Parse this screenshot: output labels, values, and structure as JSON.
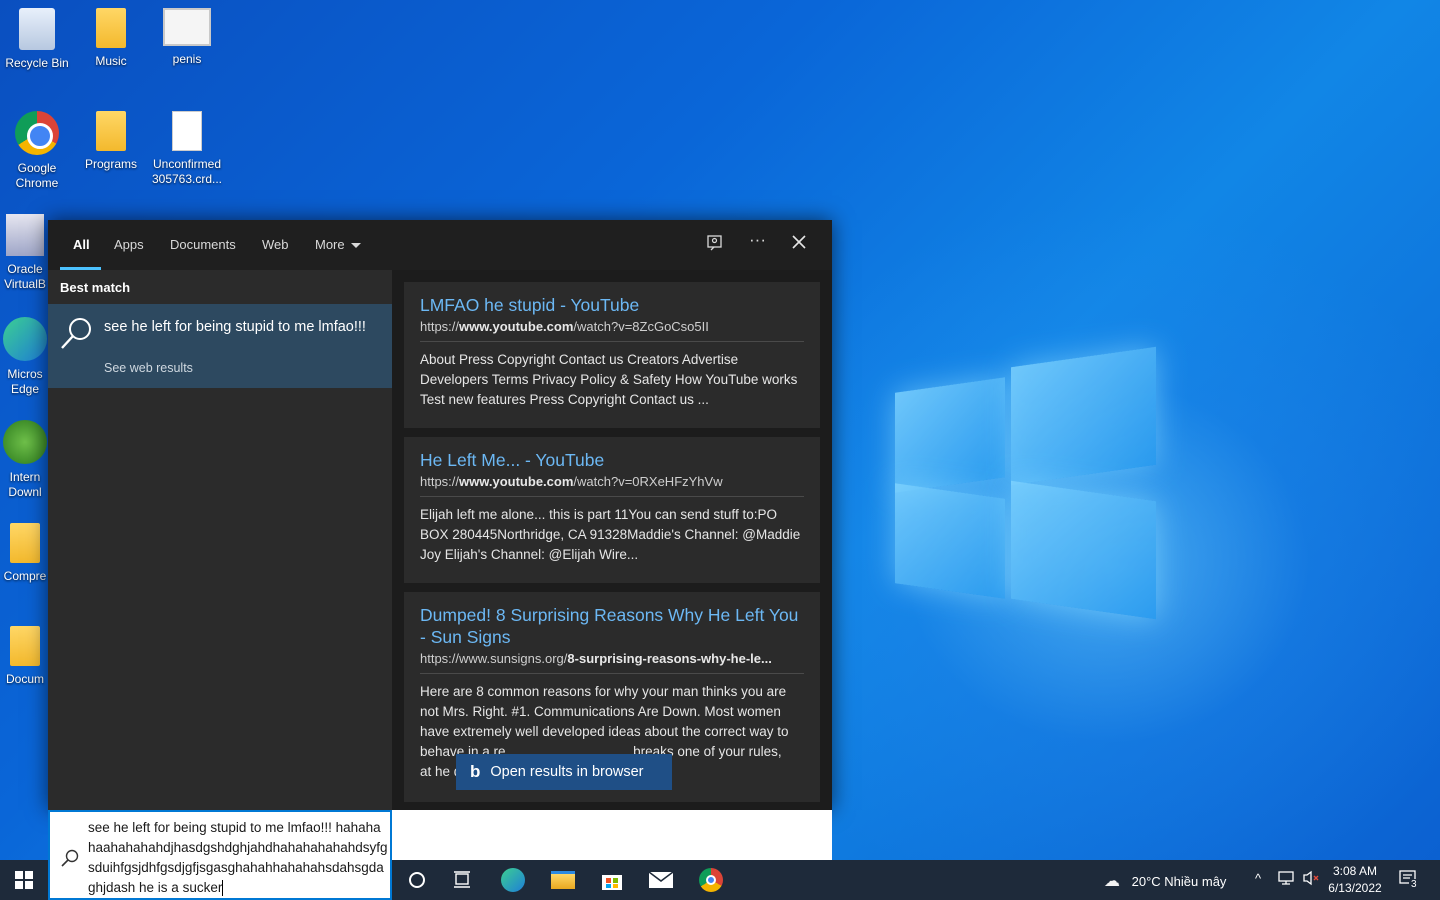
{
  "desktop": {
    "icons": [
      {
        "label": "Recycle Bin"
      },
      {
        "label": "Music"
      },
      {
        "label": "penis"
      },
      {
        "label": "Google Chrome"
      },
      {
        "label": "Programs"
      },
      {
        "label": "Unconfirmed 305763.crd..."
      },
      {
        "label": "Oracle VirtualB"
      },
      {
        "label": "Micros Edge"
      },
      {
        "label": "Intern Downl"
      },
      {
        "label": "Compre"
      },
      {
        "label": "Docum"
      }
    ]
  },
  "search": {
    "tabs": [
      "All",
      "Apps",
      "Documents",
      "Web",
      "More"
    ],
    "best_match": {
      "heading": "Best match",
      "title": "see he left for being stupid to me lmfao!!!",
      "subtitle": "See web results"
    },
    "results": [
      {
        "title": "LMFAO he stupid - YouTube",
        "url_prefix": "https://",
        "url_bold": "www.youtube.com",
        "url_suffix": "/watch?v=8ZcGoCso5II",
        "description": "About Press Copyright Contact us Creators Advertise Developers Terms Privacy Policy & Safety How YouTube works Test new features Press Copyright Contact us ..."
      },
      {
        "title": "He Left Me... - YouTube",
        "url_prefix": "https://",
        "url_bold": "www.youtube.com",
        "url_suffix": "/watch?v=0RXeHFzYhVw",
        "description": "Elijah left me alone... this is part 11You can send stuff to:PO BOX 280445Northridge, CA 91328Maddie's Channel: @Maddie Joy Elijah's Channel: @Elijah Wire..."
      },
      {
        "title": "Dumped! 8 Surprising Reasons Why He Left You - Sun Signs",
        "url_prefix": "https://www.sunsigns.org/",
        "url_bold": "8-surprising-reasons-why-he-le...",
        "url_suffix": "",
        "description": "Here are 8 common reasons for why your man thinks you are not Mrs. Right. #1. Communications Are Down. Most women have extremely well developed ideas about the correct way to behave in a re                                  breaks one of your rules,                                  at he did. B..."
      }
    ],
    "open_browser_label": "Open results in browser",
    "query": "see he left for being stupid to me lmfao!!! hahahahaahahahahdjhasdgshdghjahdhahahahahahdsyfgsduihfgsjdhfgsdjgfjsgasghahahhahahahsdahsgdaghjdash he is a sucker"
  },
  "taskbar": {
    "weather": "20°C  Nhiều mây",
    "time": "3:08 AM",
    "date": "6/13/2022",
    "notifications": "3"
  },
  "colors": {
    "accent": "#0078d4",
    "link": "#6cb8f4",
    "panel": "#2b2b2b"
  }
}
